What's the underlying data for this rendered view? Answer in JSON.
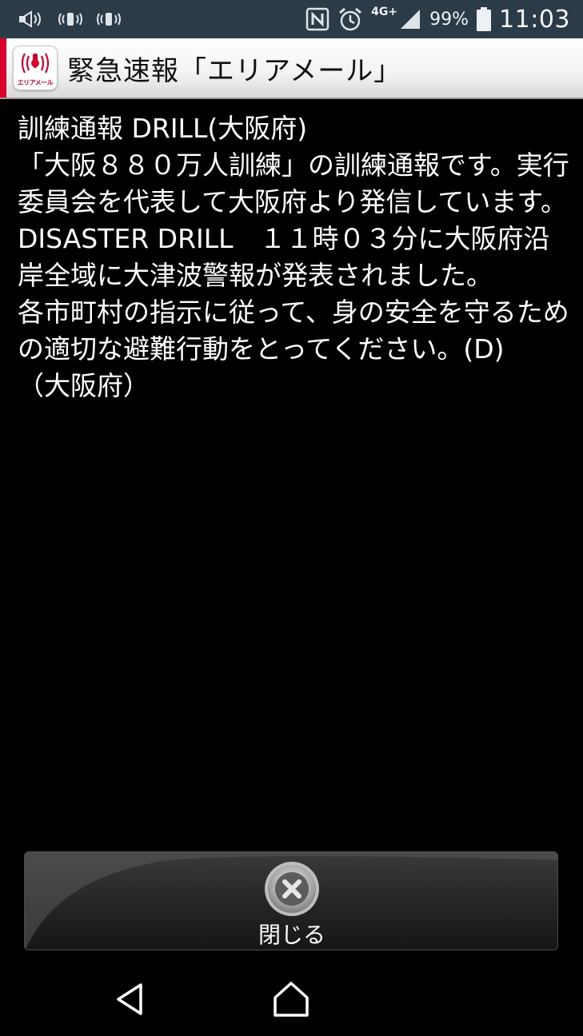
{
  "status_bar": {
    "icons": [
      "broadcast-speaker-icon",
      "vibrate-icon",
      "vibrate-icon",
      "nfc-icon",
      "alarm-icon",
      "signal-icon",
      "battery-icon"
    ],
    "network": "4G+",
    "battery": "99%",
    "time": "11:03"
  },
  "title_bar": {
    "title": "緊急速報「エリアメール」",
    "logo_text": "エリアメール",
    "accent_color": "#d9002e"
  },
  "message": {
    "lines": [
      "訓練通報 DRILL(大阪府)",
      "「大阪８８０万人訓練」の訓練通報です。実行委員会を代表して大阪府より発信しています。DISASTER DRILL　１１時０３分に大阪府沿岸全域に大津波警報が発表されました。",
      "各市町村の指示に従って、身の安全を守るための適切な避難行動をとってください。(D)",
      "（大阪府）"
    ]
  },
  "close_button": {
    "label": "閉じる"
  },
  "nav": {
    "back_icon": "back-icon",
    "home_icon": "home-icon"
  }
}
